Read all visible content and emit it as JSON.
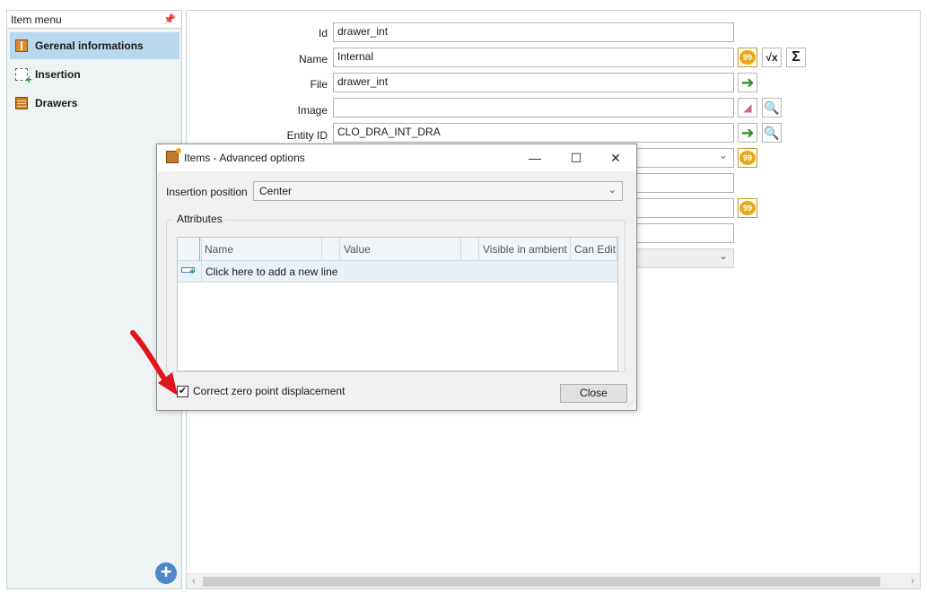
{
  "sidebar": {
    "title": "Item menu",
    "pin_icon": "pin-icon",
    "items": [
      {
        "label": "Gerenal informations",
        "icon": "cabinet-icon",
        "selected": true
      },
      {
        "label": "Insertion",
        "icon": "insertion-icon",
        "selected": false
      },
      {
        "label": "Drawers",
        "icon": "drawers-icon",
        "selected": false
      }
    ],
    "add_icon": "add-circle-icon"
  },
  "properties": {
    "id": {
      "label": "Id",
      "value": "drawer_int"
    },
    "name": {
      "label": "Name",
      "value": "Internal"
    },
    "file": {
      "label": "File",
      "value": "drawer_int"
    },
    "image": {
      "label": "Image",
      "value": ""
    },
    "entity_id": {
      "label": "Entity ID",
      "value": "CLO_DRA_INT_DRA"
    }
  },
  "dialog": {
    "title": "Items - Advanced options",
    "minimize_glyph": "—",
    "maximize_glyph": "☐",
    "close_glyph": "✕",
    "insertion_label": "Insertion position",
    "insertion_value": "Center",
    "attributes_title": "Attributes",
    "columns": [
      "Name",
      "Value",
      "Visible in ambient",
      "Can Edit"
    ],
    "new_line_text": "Click here to add a new line",
    "checkbox_label": "Correct zero point displacement",
    "checkbox_checked": true,
    "close_label": "Close"
  },
  "colors": {
    "selection": "#b8d8ee",
    "arrow": "#e0141e",
    "accent_blue": "#4c88c9"
  }
}
